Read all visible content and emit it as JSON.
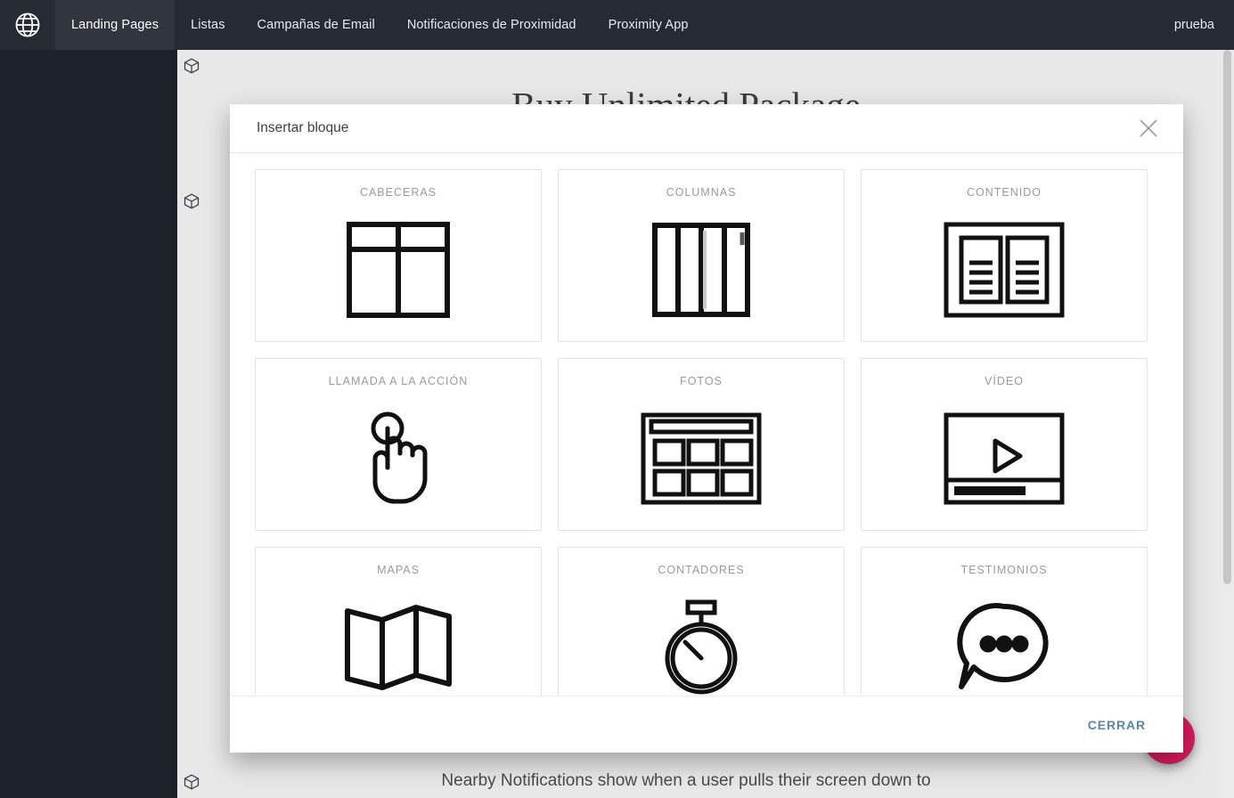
{
  "topnav": {
    "logo_icon": "globe-icon",
    "items": [
      {
        "label": "Landing Pages",
        "active": true
      },
      {
        "label": "Listas",
        "active": false
      },
      {
        "label": "Campañas de Email",
        "active": false
      },
      {
        "label": "Notificaciones de Proximidad",
        "active": false
      },
      {
        "label": "Proximity App",
        "active": false
      }
    ],
    "user": "prueba",
    "background_color": "#262b33",
    "active_background_color": "#30353e"
  },
  "page": {
    "heading": "Buy Unlimited Package",
    "subtext": "Nearby Notifications show when a user pulls their screen down to",
    "canvas_background": "#e8e8e8",
    "block_marker_icon": "cube-icon",
    "fab": {
      "icon": "plus-icon",
      "color": "#d81b60"
    }
  },
  "modal": {
    "title": "Insertar bloque",
    "close_icon": "close-icon",
    "footer": {
      "close_label": "CERRAR",
      "close_color": "#5a86a8"
    },
    "blocks": [
      {
        "label": "CABECERAS",
        "icon": "header-layout-icon"
      },
      {
        "label": "COLUMNAS",
        "icon": "columns-layout-icon"
      },
      {
        "label": "CONTENIDO",
        "icon": "content-columns-icon"
      },
      {
        "label": "LLAMADA A LA ACCIÓN",
        "icon": "pointing-hand-icon"
      },
      {
        "label": "FOTOS",
        "icon": "photo-gallery-icon"
      },
      {
        "label": "VÍDEO",
        "icon": "video-player-icon"
      },
      {
        "label": "MAPAS",
        "icon": "folded-map-icon"
      },
      {
        "label": "CONTADORES",
        "icon": "stopwatch-icon"
      },
      {
        "label": "TESTIMONIOS",
        "icon": "speech-bubble-icon"
      }
    ]
  }
}
